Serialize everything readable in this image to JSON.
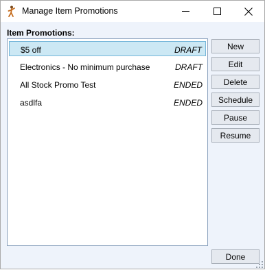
{
  "window": {
    "title": "Manage Item Promotions",
    "icon": "app-figure-icon"
  },
  "list": {
    "label": "Item Promotions:",
    "items": [
      {
        "name": "$5 off",
        "status": "DRAFT",
        "selected": true
      },
      {
        "name": "Electronics - No minimum purchase",
        "status": "DRAFT",
        "selected": false
      },
      {
        "name": "All Stock Promo Test",
        "status": "ENDED",
        "selected": false
      },
      {
        "name": "asdlfa",
        "status": "ENDED",
        "selected": false
      }
    ]
  },
  "buttons": {
    "new": "New",
    "edit": "Edit",
    "delete": "Delete",
    "schedule": "Schedule",
    "pause": "Pause",
    "resume": "Resume",
    "done": "Done"
  },
  "colors": {
    "window_bg": "#eef3fb",
    "selection_bg": "#cce8f4",
    "selection_border": "#75b6d9"
  }
}
